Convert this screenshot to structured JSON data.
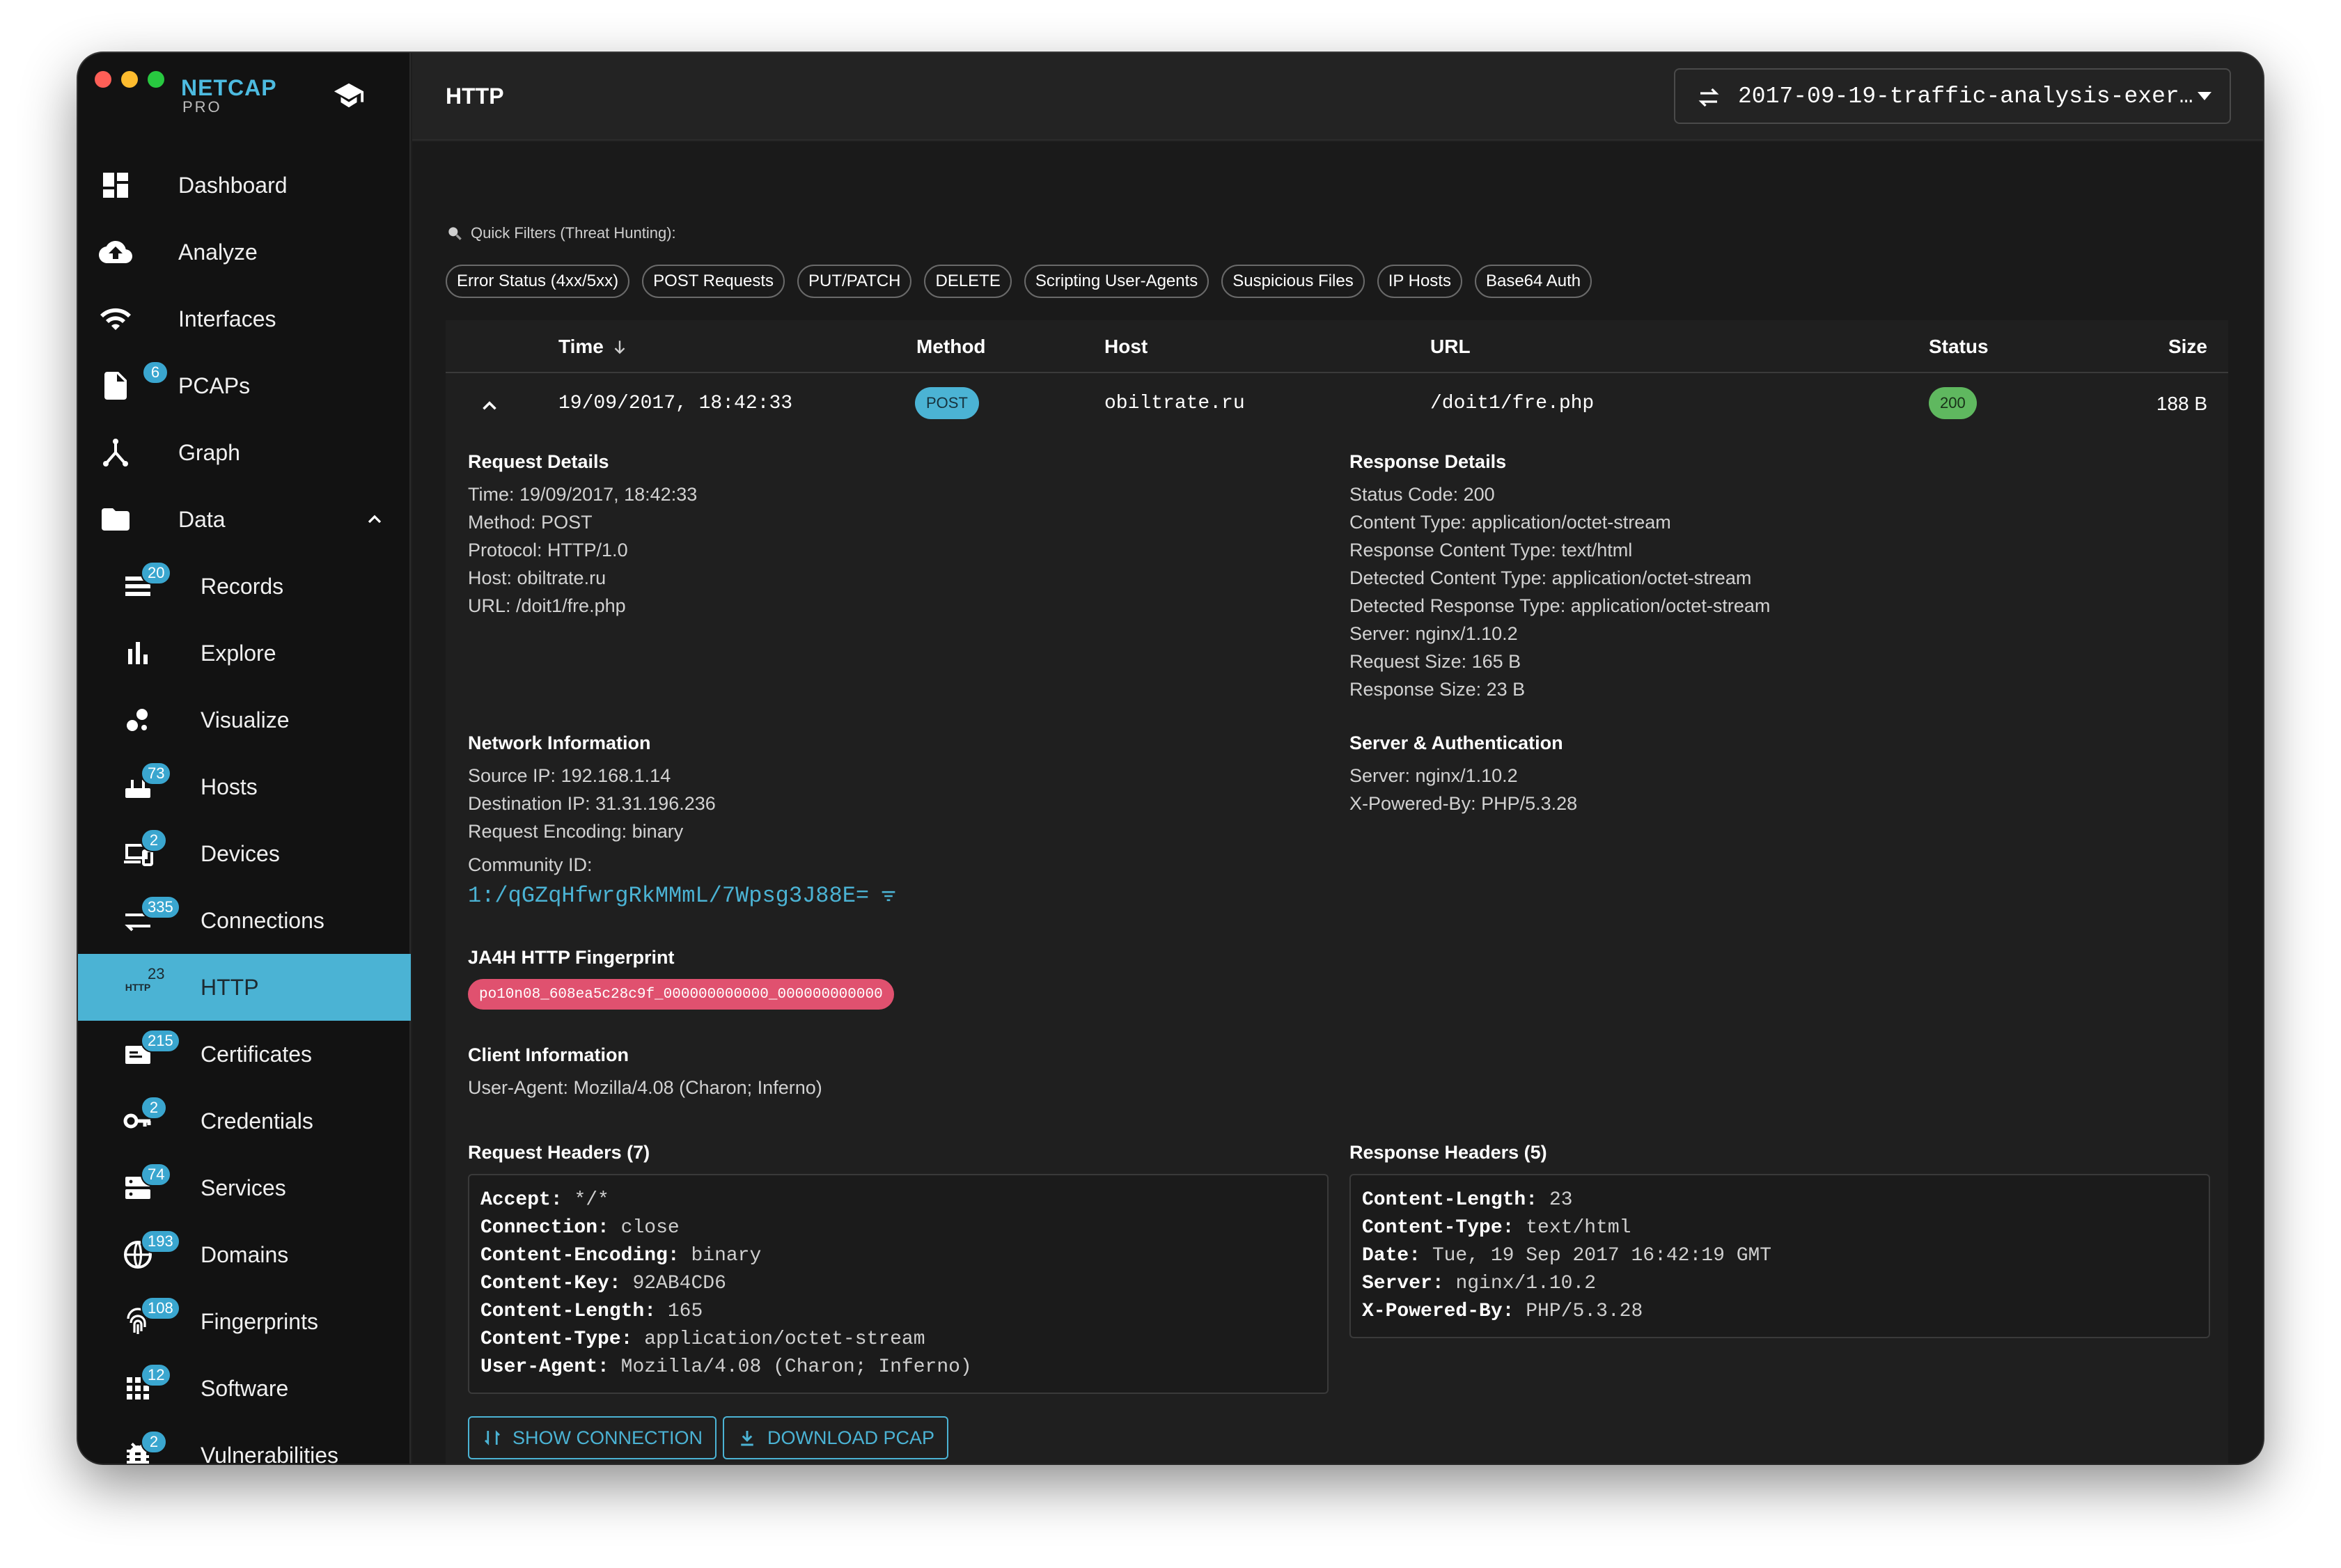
{
  "sidebar": {
    "brand": {
      "name": "NETCAP",
      "sub": "PRO"
    },
    "items": [
      {
        "label": "Dashboard",
        "icon": "dashboard-icon"
      },
      {
        "label": "Analyze",
        "icon": "cloud-upload-icon"
      },
      {
        "label": "Interfaces",
        "icon": "wifi-icon"
      },
      {
        "label": "PCAPs",
        "icon": "file-icon",
        "badge": "6"
      },
      {
        "label": "Graph",
        "icon": "graph-icon"
      },
      {
        "label": "Data",
        "icon": "folder-icon",
        "expanded": true
      }
    ],
    "data_items": [
      {
        "label": "Records",
        "icon": "records-icon",
        "badge": "20"
      },
      {
        "label": "Explore",
        "icon": "bar-chart-icon"
      },
      {
        "label": "Visualize",
        "icon": "bubbles-icon"
      },
      {
        "label": "Hosts",
        "icon": "router-icon",
        "badge": "73"
      },
      {
        "label": "Devices",
        "icon": "devices-icon",
        "badge": "2"
      },
      {
        "label": "Connections",
        "icon": "connections-icon",
        "badge": "335"
      },
      {
        "label": "HTTP",
        "icon": "http-icon",
        "badge": "23",
        "icon_text": "HTTP",
        "active": true
      },
      {
        "label": "Certificates",
        "icon": "certificate-icon",
        "badge": "215"
      },
      {
        "label": "Credentials",
        "icon": "key-icon",
        "badge": "2"
      },
      {
        "label": "Services",
        "icon": "services-icon",
        "badge": "74"
      },
      {
        "label": "Domains",
        "icon": "globe-icon",
        "badge": "193"
      },
      {
        "label": "Fingerprints",
        "icon": "fingerprint-icon",
        "badge": "108"
      },
      {
        "label": "Software",
        "icon": "apps-grid-icon",
        "badge": "12"
      },
      {
        "label": "Vulnerabilities",
        "icon": "bug-icon",
        "badge": "2"
      }
    ]
  },
  "header": {
    "title": "HTTP",
    "file": "2017-09-19-traffic-analysis-exer…"
  },
  "quick_filters": {
    "label": "Quick Filters (Threat Hunting):",
    "chips": [
      "Error Status (4xx/5xx)",
      "POST Requests",
      "PUT/PATCH",
      "DELETE",
      "Scripting User-Agents",
      "Suspicious Files",
      "IP Hosts",
      "Base64 Auth"
    ]
  },
  "table": {
    "columns": [
      "Time",
      "Method",
      "Host",
      "URL",
      "Status",
      "Size"
    ],
    "row": {
      "time": "19/09/2017, 18:42:33",
      "method": "POST",
      "host": "obiltrate.ru",
      "url": "/doit1/fre.php",
      "status": "200",
      "size": "188 B"
    }
  },
  "details": {
    "request": {
      "title": "Request Details",
      "lines": [
        "Time: 19/09/2017, 18:42:33",
        "Method: POST",
        "Protocol: HTTP/1.0",
        "Host: obiltrate.ru",
        "URL: /doit1/fre.php"
      ]
    },
    "response": {
      "title": "Response Details",
      "lines": [
        "Status Code: 200",
        "Content Type: application/octet-stream",
        "Response Content Type: text/html",
        "Detected Content Type: application/octet-stream",
        "Detected Response Type: application/octet-stream",
        "Server: nginx/1.10.2",
        "Request Size: 165 B",
        "Response Size: 23 B"
      ]
    },
    "network": {
      "title": "Network Information",
      "lines": [
        "Source IP: 192.168.1.14",
        "Destination IP: 31.31.196.236",
        "Request Encoding: binary"
      ],
      "community_label": "Community ID:",
      "community_id": "1:/qGZqHfwrgRkMMmL/7Wpsg3J88E="
    },
    "server_auth": {
      "title": "Server & Authentication",
      "lines": [
        "Server: nginx/1.10.2",
        "X-Powered-By: PHP/5.3.28"
      ]
    },
    "ja4h": {
      "title": "JA4H HTTP Fingerprint",
      "value": "po10n08_608ea5c28c9f_000000000000_000000000000"
    },
    "client": {
      "title": "Client Information",
      "user_agent": "User-Agent: Mozilla/4.08 (Charon; Inferno)"
    },
    "request_headers": {
      "title": "Request Headers (7)",
      "items": [
        {
          "k": "Accept:",
          "v": "*/*"
        },
        {
          "k": "Connection:",
          "v": "close"
        },
        {
          "k": "Content-Encoding:",
          "v": "binary"
        },
        {
          "k": "Content-Key:",
          "v": "92AB4CD6"
        },
        {
          "k": "Content-Length:",
          "v": "165"
        },
        {
          "k": "Content-Type:",
          "v": "application/octet-stream"
        },
        {
          "k": "User-Agent:",
          "v": "Mozilla/4.08 (Charon; Inferno)"
        }
      ]
    },
    "response_headers": {
      "title": "Response Headers (5)",
      "items": [
        {
          "k": "Content-Length:",
          "v": "23"
        },
        {
          "k": "Content-Type:",
          "v": "text/html"
        },
        {
          "k": "Date:",
          "v": "Tue, 19 Sep 2017 16:42:19 GMT"
        },
        {
          "k": "Server:",
          "v": "nginx/1.10.2"
        },
        {
          "k": "X-Powered-By:",
          "v": "PHP/5.3.28"
        }
      ]
    },
    "actions": {
      "show_connection": "SHOW CONNECTION",
      "download_pcap": "DOWNLOAD PCAP"
    }
  },
  "colors": {
    "accent": "#4bb3d4",
    "success": "#5fb85f",
    "ja4_pill": "#e0516f",
    "sidebar_bg": "#121212"
  }
}
